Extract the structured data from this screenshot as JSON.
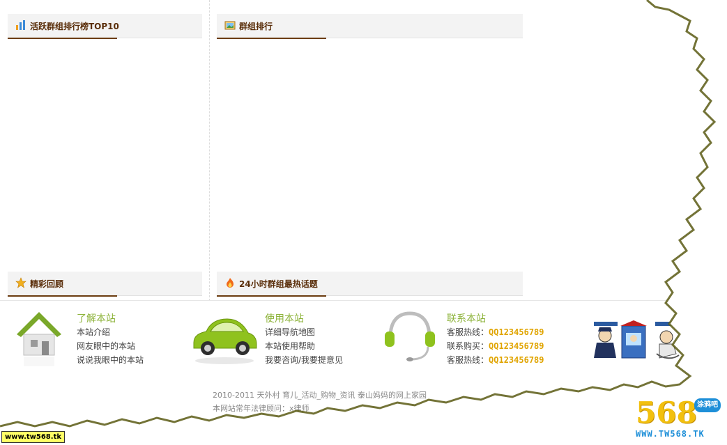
{
  "panels": {
    "active_top10": {
      "title": "活跃群组排行榜TOP10"
    },
    "group_rank": {
      "title": "群组排行"
    },
    "highlights": {
      "title": "精彩回顾"
    },
    "hot_topics": {
      "title": "24小时群组最热话题"
    }
  },
  "footer_cols": {
    "about": {
      "title": "了解本站",
      "links": [
        "本站介绍",
        "网友眼中的本站",
        "说说我眼中的本站"
      ]
    },
    "usage": {
      "title": "使用本站",
      "links": [
        "详细导航地图",
        "本站使用帮助",
        "我要咨询/我要提意见"
      ]
    },
    "contact": {
      "title": "联系本站",
      "lines": [
        {
          "label": "客服热线：",
          "value": "QQ123456789"
        },
        {
          "label": "联系购买：",
          "value": "QQ123456789"
        },
        {
          "label": "客服热线：",
          "value": "QQ123456789"
        }
      ]
    }
  },
  "footer": {
    "copyright": "2010-2011  天外村  育儿_活动_购物_资讯  泰山妈妈的网上家园",
    "legal": "本网站常年法律顾问：x律师"
  },
  "watermark": {
    "tag": "www.tw568.tk",
    "logo_num": "568",
    "logo_badge": "涂鸦吧",
    "logo_url": "WWW.TW568.TK"
  },
  "colors": {
    "accent_brown": "#6b3c10",
    "accent_green": "#8db33a",
    "qq_yellow": "#e0a400"
  }
}
